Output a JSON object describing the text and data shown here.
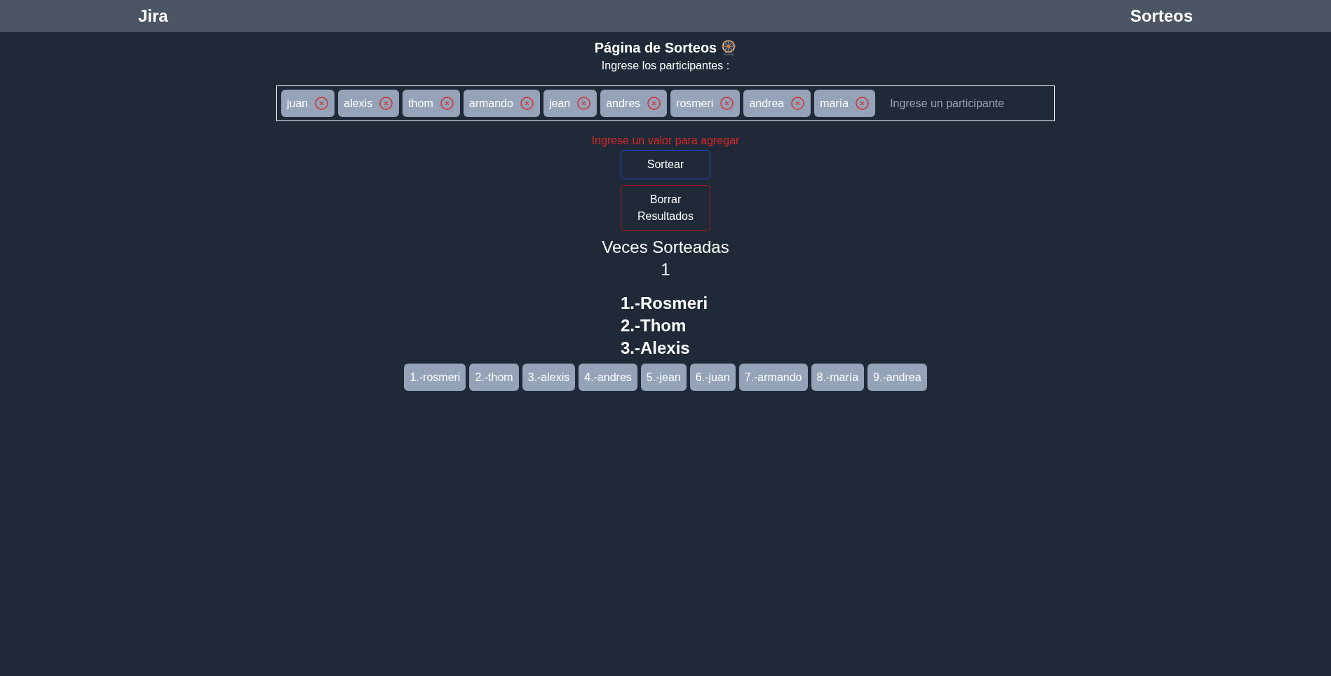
{
  "navbar": {
    "brand": "Jira",
    "link": "Sorteos"
  },
  "header": {
    "title": "Página de Sorteos",
    "subtitle": "Ingrese los participantes :"
  },
  "participants_input": {
    "tags": [
      "juan",
      "alexis",
      "thom",
      "armando",
      "jean",
      "andres",
      "rosmeri",
      "andrea",
      "maría"
    ],
    "placeholder": "Ingrese un participante"
  },
  "error_message": "Ingrese un valor para agregar",
  "buttons": [
    {
      "kind": "draw",
      "label": "Sortear"
    },
    {
      "kind": "clear",
      "label": "Borrar Resultados"
    }
  ],
  "draw_count": {
    "label": "Veces Sorteadas",
    "value": "1"
  },
  "winners": [
    "1.-Rosmeri",
    "2.-Thom",
    "3.-Alexis"
  ],
  "draw_order": [
    "1.-rosmeri",
    "2.-thom",
    "3.-alexis",
    "4.-andres",
    "5.-jean",
    "6.-juan",
    "7.-armando",
    "8.-maría",
    "9.-andrea"
  ]
}
